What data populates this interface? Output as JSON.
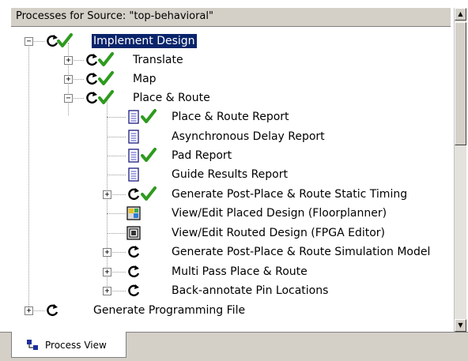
{
  "panel_title": "Processes for Source: \"top-behavioral\"",
  "tab_label": "Process View",
  "nodes": [
    {
      "label": "Implement Design",
      "icon": "process-running-icon",
      "status": "check-icon",
      "expander": "−",
      "selected": true
    },
    {
      "label": "Translate",
      "icon": "process-running-icon",
      "status": "check-icon",
      "expander": "+"
    },
    {
      "label": "Map",
      "icon": "process-running-icon",
      "status": "check-icon",
      "expander": "+"
    },
    {
      "label": "Place & Route",
      "icon": "process-running-icon",
      "status": "check-icon",
      "expander": "−"
    },
    {
      "label": "Place & Route Report",
      "icon": "report-icon",
      "status": "check-icon"
    },
    {
      "label": "Asynchronous Delay Report",
      "icon": "report-icon"
    },
    {
      "label": "Pad Report",
      "icon": "report-icon",
      "status": "check-icon"
    },
    {
      "label": "Guide Results Report",
      "icon": "report-icon"
    },
    {
      "label": "Generate Post-Place & Route Static Timing",
      "icon": "process-running-icon",
      "status": "check-icon",
      "expander": "+"
    },
    {
      "label": "View/Edit Placed Design (Floorplanner)",
      "icon": "floorplanner-icon"
    },
    {
      "label": "View/Edit Routed Design (FPGA Editor)",
      "icon": "fpga-editor-icon"
    },
    {
      "label": "Generate Post-Place & Route Simulation Model",
      "icon": "process-running-icon",
      "expander": "+"
    },
    {
      "label": "Multi Pass Place & Route",
      "icon": "process-running-icon",
      "expander": "+"
    },
    {
      "label": "Back-annotate Pin Locations",
      "icon": "process-running-icon",
      "expander": "+"
    },
    {
      "label": "Generate Programming File",
      "icon": "process-running-icon",
      "expander": "+"
    }
  ],
  "colors": {
    "selection": "#0a246a",
    "check": "#2e9a1e"
  }
}
